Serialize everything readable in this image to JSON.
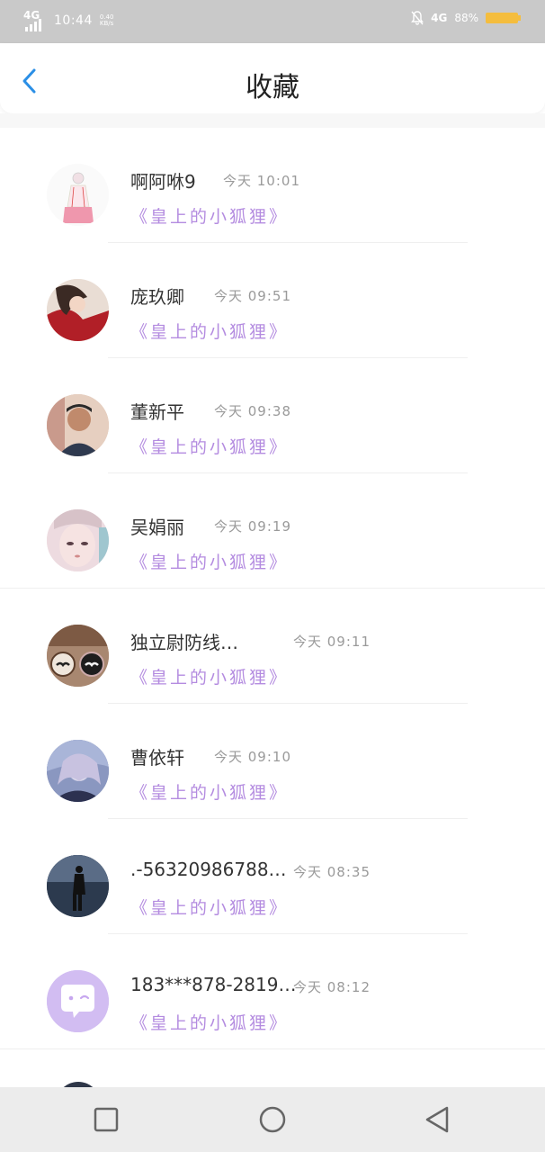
{
  "status_bar": {
    "network_left": "4G",
    "time": "10:44",
    "speed": "0.40 KB/s",
    "network_right": "4G",
    "battery_percent": "88%",
    "battery_color": "#f4bd3e"
  },
  "header": {
    "title": "收藏",
    "back_icon": "chevron-left-icon",
    "accent_color": "#2b8fe6"
  },
  "favorites": [
    {
      "name": "啊阿咻9",
      "time": "今天 10:01",
      "message": "《皇上的小狐狸》"
    },
    {
      "name": "庞玖卿",
      "time": "今天 09:51",
      "message": "《皇上的小狐狸》"
    },
    {
      "name": "董新平",
      "time": "今天 09:38",
      "message": "《皇上的小狐狸》"
    },
    {
      "name": "吴娟丽",
      "time": "今天 09:19",
      "message": "《皇上的小狐狸》"
    },
    {
      "name": "独立尉防线…",
      "time": "今天 09:11",
      "message": "《皇上的小狐狸》"
    },
    {
      "name": "曹依轩",
      "time": "今天 09:10",
      "message": "《皇上的小狐狸》"
    },
    {
      "name": ".-56320986788…",
      "time": "今天 08:35",
      "message": "《皇上的小狐狸》"
    },
    {
      "name": "183***878-2819…",
      "time": "今天 08:12",
      "message": "《皇上的小狐狸》"
    }
  ],
  "message_color": "#b48ce0",
  "nav_bar": {
    "recent_icon": "square-icon",
    "home_icon": "circle-icon",
    "back_icon": "triangle-back-icon"
  }
}
